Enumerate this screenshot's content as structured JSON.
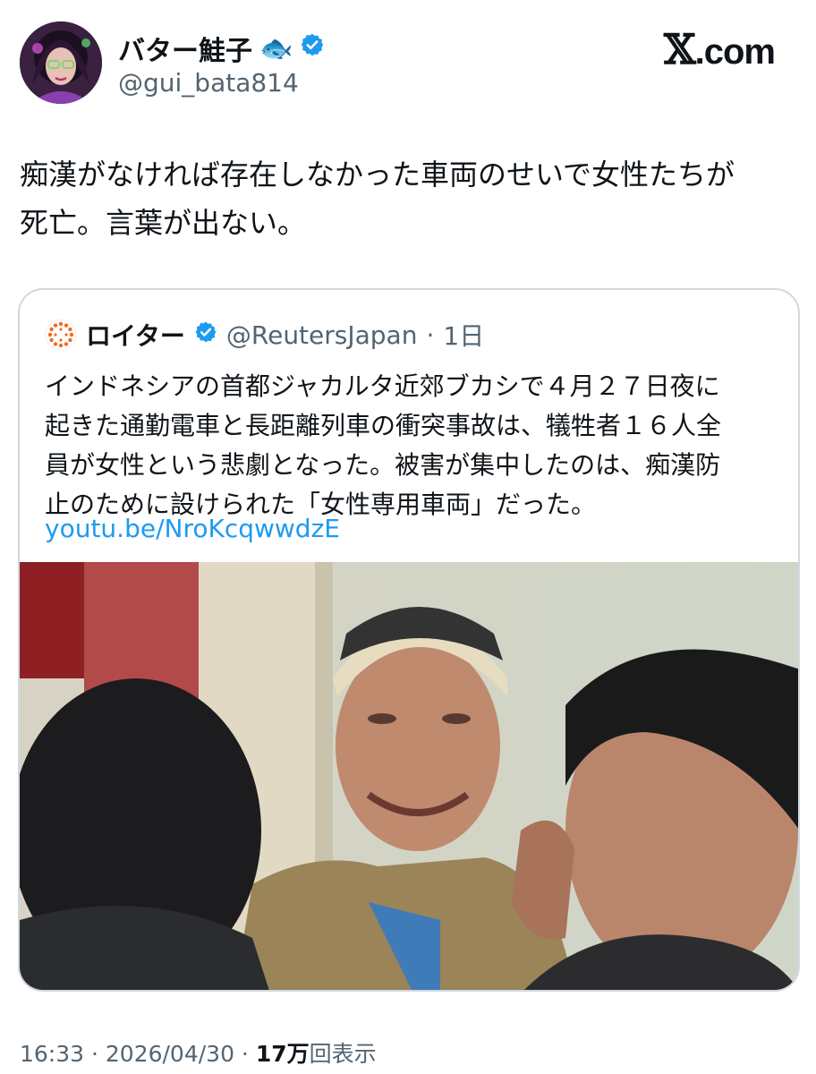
{
  "author": {
    "display_name": "バター鮭子",
    "emoji": "🐟",
    "handle": "@gui_bata814",
    "verified_icon": "verified-badge-icon"
  },
  "brand": {
    "prefix": "𝕏",
    "suffix": ".com"
  },
  "tweet": {
    "text": "痴漢がなければ存在しなかった車両のせいで女性たちが\n死亡。言葉が出ない。"
  },
  "quote": {
    "logo_icon": "reuters-logo-icon",
    "name": "ロイター",
    "handle": "@ReutersJapan",
    "separator": "·",
    "time": "1日",
    "text": "インドネシアの首都ジャカルタ近郊ブカシで４月２７日夜に\n起きた通勤電車と長距離列車の衝突事故は、犠牲者１６人全\n員が女性という悲劇となった。被害が集中したのは、痴漢防\n止のために設けられた「女性専用車両」だった。",
    "link": "youtu.be/NroKcqwwdzE",
    "media_icon": "photo-grieving-man-icon"
  },
  "footer": {
    "time": "16:33",
    "sep1": " · ",
    "date": "2026/04/30",
    "sep2": " · ",
    "views_count": "17万",
    "views_label": "回表示"
  },
  "colors": {
    "text": "#0f1419",
    "muted": "#536471",
    "link": "#1d9bf0",
    "verified": "#1d9bf0",
    "reuters_orange": "#f26b21"
  }
}
